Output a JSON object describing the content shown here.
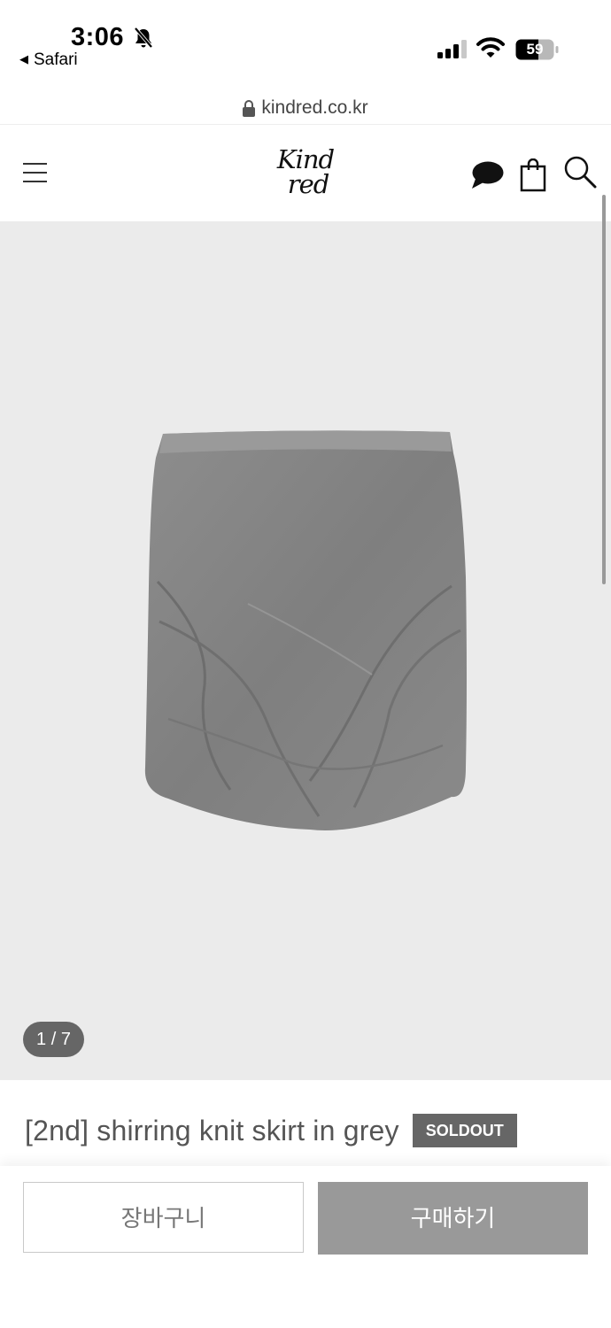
{
  "status_bar": {
    "time": "3:06",
    "back_app": "Safari",
    "battery": "59"
  },
  "url_bar": {
    "domain": "kindred.co.kr"
  },
  "header": {
    "logo_line1": "Kind",
    "logo_line2": "red",
    "icons": [
      "menu-icon",
      "chat-icon",
      "shopping-bag-icon",
      "search-icon"
    ]
  },
  "product": {
    "image_counter": "1 / 7",
    "title": "[2nd] shirring knit skirt in grey",
    "badge": "SOLDOUT"
  },
  "bottom_bar": {
    "cart_label": "장바구니",
    "buy_label": "구매하기"
  },
  "colors": {
    "image_bg": "#ebebeb",
    "badge_bg": "#666666",
    "buy_button_bg": "#999999"
  }
}
